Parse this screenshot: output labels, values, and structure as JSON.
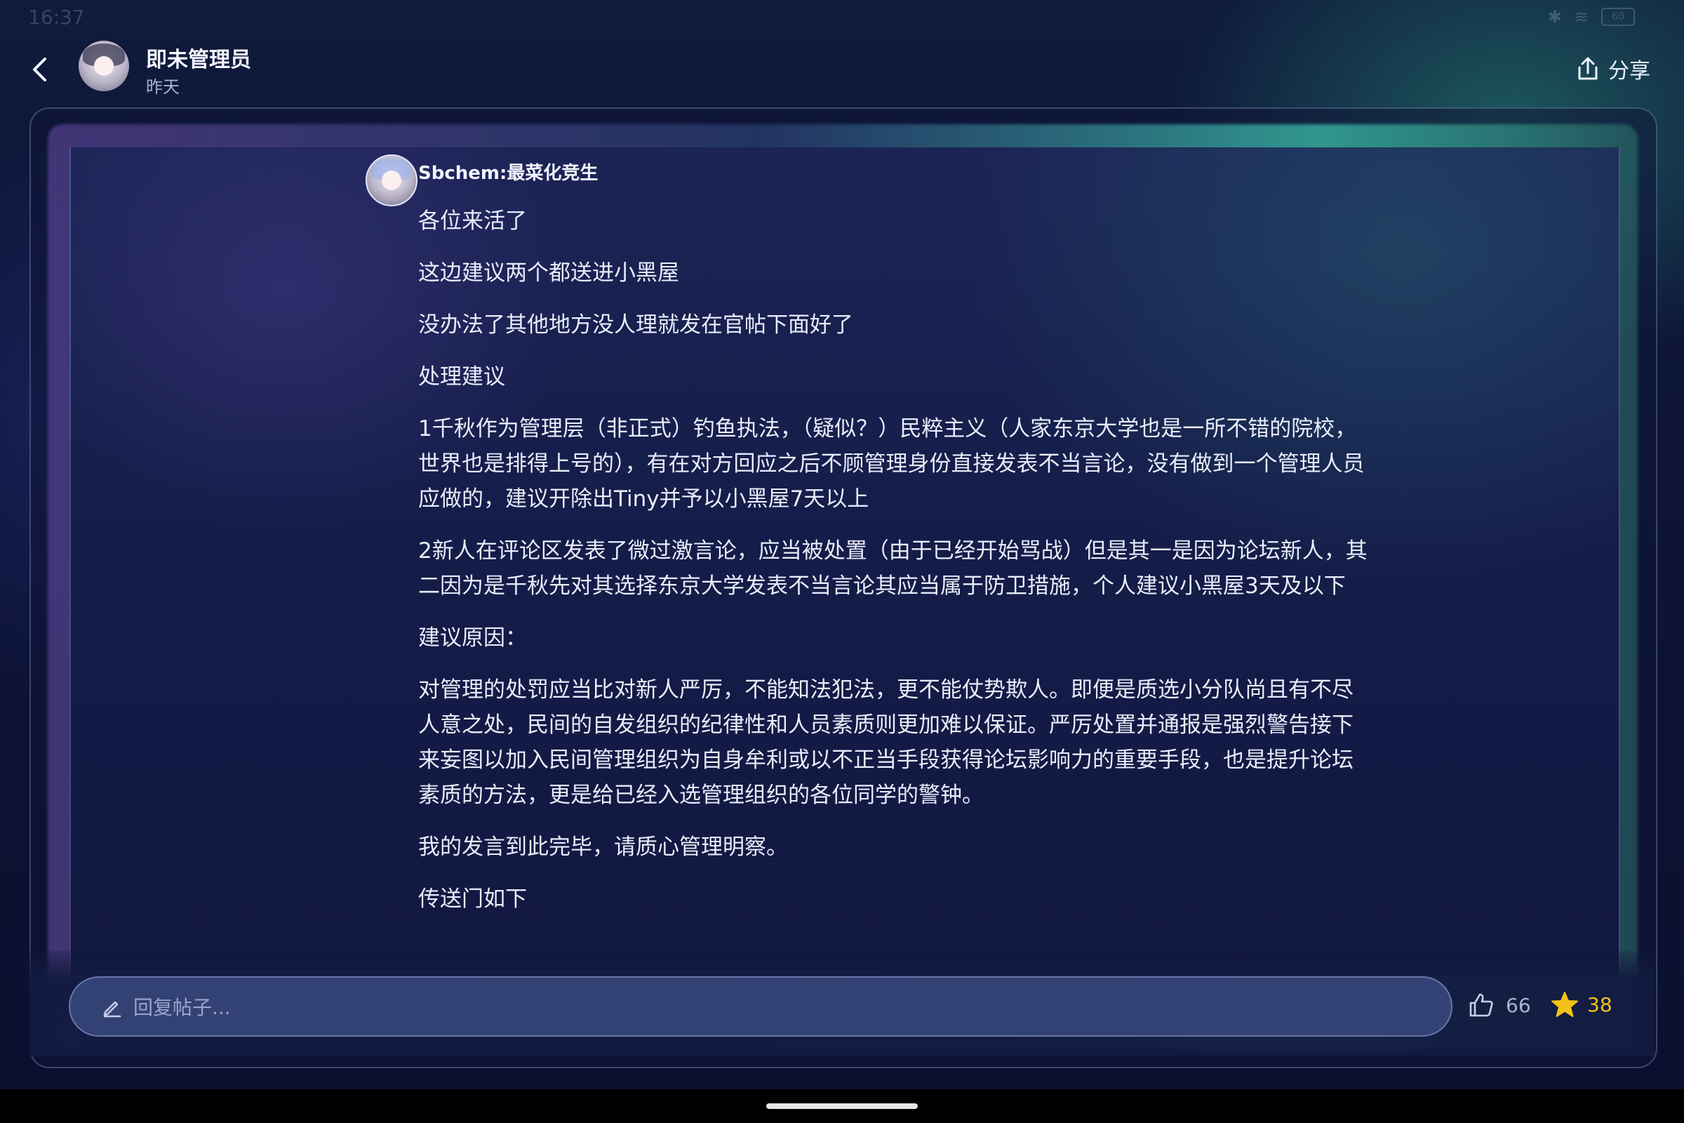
{
  "status_bar": {
    "time": "16:37",
    "bluetooth_icon": "bluetooth-icon",
    "wifi_icon": "wifi-icon",
    "battery_level": "60"
  },
  "header": {
    "back_icon": "chevron-left-icon",
    "author": "即未管理员",
    "time": "昨天",
    "share_icon": "share-icon",
    "share_label": "分享"
  },
  "comment": {
    "author": "Sbchem:最菜化竞生",
    "paragraphs": [
      "各位来活了",
      "这边建议两个都送进小黑屋",
      "没办法了其他地方没人理就发在官帖下面好了",
      "处理建议",
      "1千秋作为管理层（非正式）钓鱼执法，（疑似？）民粹主义（人家东京大学也是一所不错的院校，世界也是排得上号的），有在对方回应之后不顾管理身份直接发表不当言论，没有做到一个管理人员应做的，建议开除出Tiny并予以小黑屋7天以上",
      "2新人在评论区发表了微过激言论，应当被处置（由于已经开始骂战）但是其一是因为论坛新人，其二因为是千秋先对其选择东京大学发表不当言论其应当属于防卫措施，个人建议小黑屋3天及以下",
      "建议原因：",
      "对管理的处罚应当比对新人严厉，不能知法犯法，更不能仗势欺人。即便是质选小分队尚且有不尽人意之处，民间的自发组织的纪律性和人员素质则更加难以保证。严厉处置并通报是强烈警告接下来妄图以加入民间管理组织为自身牟利或以不正当手段获得论坛影响力的重要手段，也是提升论坛素质的方法，更是给已经入选管理组织的各位同学的警钟。",
      "我的发言到此完毕，请质心管理明察。",
      "传送门如下"
    ]
  },
  "reply_bar": {
    "placeholder": "回复帖子...",
    "pencil_icon": "pencil-icon",
    "like_icon": "thumbs-up-icon",
    "like_count": "66",
    "favorite_icon": "star-icon",
    "favorite_count": "38",
    "favorite_color": "#f2c218"
  }
}
